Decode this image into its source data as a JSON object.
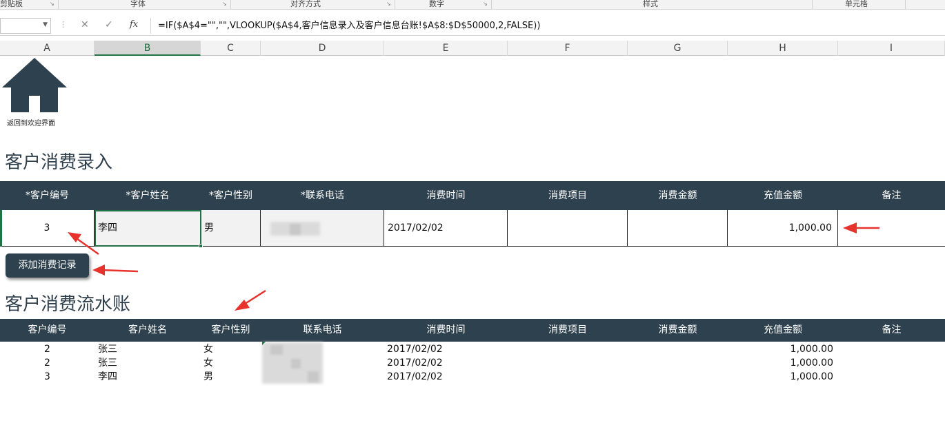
{
  "ribbon": {
    "groups": [
      {
        "label": "剪贴板"
      },
      {
        "label": "字体"
      },
      {
        "label": "对齐方式"
      },
      {
        "label": "数字"
      },
      {
        "label": "样式"
      },
      {
        "label": "单元格"
      }
    ]
  },
  "formula_bar": {
    "name_box": "",
    "cancel_icon": "close-icon",
    "confirm_icon": "check-icon",
    "fx_label": "fx",
    "formula": "=IF($A$4=\"\",\"\",VLOOKUP($A$4,客户信息录入及客户信息台账!$A$8:$D$50000,2,FALSE))"
  },
  "columns": [
    "A",
    "B",
    "C",
    "D",
    "E",
    "F",
    "G",
    "H",
    "I"
  ],
  "selected_column": "B",
  "home": {
    "icon": "home-icon",
    "label": "返回到欢迎界面"
  },
  "entry_section": {
    "title": "客户消费录入",
    "headers": [
      "*客户编号",
      "*客户姓名",
      "*客户性别",
      "*联系电话",
      "消费时间",
      "消费项目",
      "消费金额",
      "充值金额",
      "备注"
    ],
    "row": {
      "id": "3",
      "name": "李四",
      "gender": "男",
      "phone": "",
      "time": "2017/02/02",
      "item": "",
      "amount": "",
      "recharge": "1,000.00",
      "note": ""
    },
    "button_label": "添加消费记录"
  },
  "ledger_section": {
    "title": "客户消费流水账",
    "headers": [
      "客户编号",
      "客户姓名",
      "客户性别",
      "联系电话",
      "消费时间",
      "消费项目",
      "消费金额",
      "充值金额",
      "备注"
    ],
    "rows": [
      {
        "id": "2",
        "name": "张三",
        "gender": "女",
        "time": "2017/02/02",
        "recharge": "1,000.00"
      },
      {
        "id": "2",
        "name": "张三",
        "gender": "女",
        "time": "2017/02/02",
        "recharge": "1,000.00"
      },
      {
        "id": "3",
        "name": "李四",
        "gender": "男",
        "time": "2017/02/02",
        "recharge": "1,000.00"
      }
    ]
  },
  "colors": {
    "header_bg": "#2e414f",
    "selection": "#217346",
    "annotation_arrow": "#e8322d"
  }
}
